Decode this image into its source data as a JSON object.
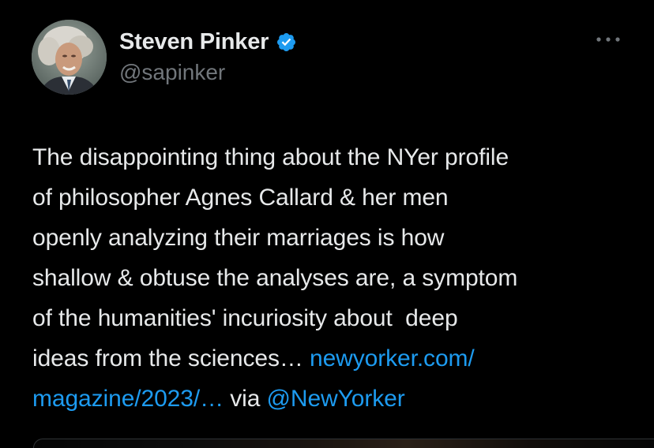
{
  "author": {
    "display_name": "Steven Pinker",
    "handle": "@sapinker",
    "verified": true,
    "avatar_icon": "profile-photo"
  },
  "tweet": {
    "text_before_link": "The disappointing thing about the NYer profile\nof philosopher Agnes Callard & her men\nopenly analyzing their marriages is how\nshallow & obtuse the analyses are, a symptom\nof the humanities' incuriosity about  deep\nideas from the sciences… ",
    "link_text_line1": "newyorker.com/",
    "link_text_line2": "magazine/2023/…",
    "via_text": " via ",
    "mention": "@NewYorker"
  },
  "colors": {
    "background": "#000000",
    "text": "#e7e9ea",
    "secondary": "#71767b",
    "link": "#1d9bf0",
    "verified_badge": "#1d9bf0"
  }
}
